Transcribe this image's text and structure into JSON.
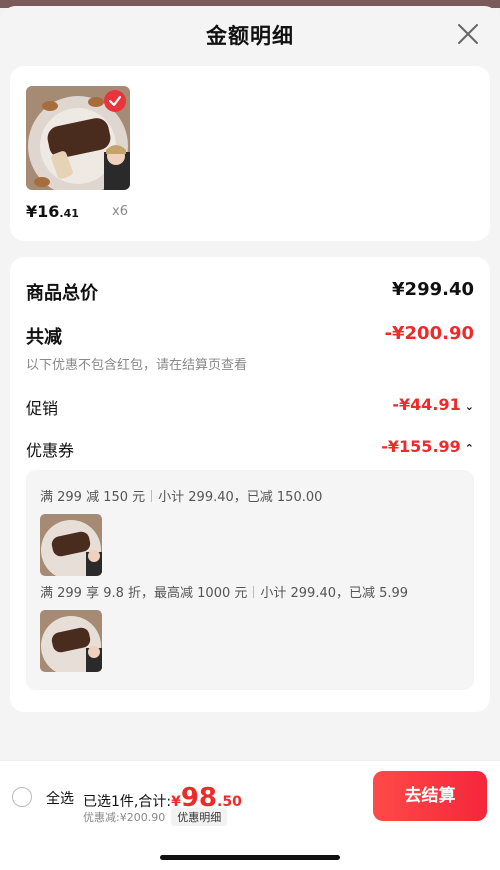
{
  "header": {
    "title": "金额明细"
  },
  "product": {
    "price_int": "¥16",
    "price_dec": ".41",
    "qty": "x6"
  },
  "summary": {
    "goods_total_label": "商品总价",
    "goods_total_value": "¥299.40",
    "total_reduce_label": "共减",
    "total_reduce_value": "-¥200.90",
    "note": "以下优惠不包含红包，请在结算页查看",
    "promo_label": "促销",
    "promo_value": "-¥44.91",
    "coupon_label": "优惠券",
    "coupon_value": "-¥155.99"
  },
  "coupons": [
    {
      "rule": "满 299 减 150 元",
      "detail": "小计 299.40，已减 150.00"
    },
    {
      "rule": "满 299 享 9.8 折，最高减 1000 元",
      "detail": "小计 299.40，已减 5.99"
    }
  ],
  "footer": {
    "select_all": "全选",
    "selected_text": "已选1件,合计:",
    "total_sym": "¥",
    "total_int": "98",
    "total_dec": ".50",
    "discount_text": "优惠减:¥200.90",
    "detail_button": "优惠明细",
    "checkout_label": "去结算"
  },
  "colors": {
    "accent": "#ef2a2a",
    "checkout_start": "#ff4a48",
    "checkout_end": "#f5263b"
  }
}
